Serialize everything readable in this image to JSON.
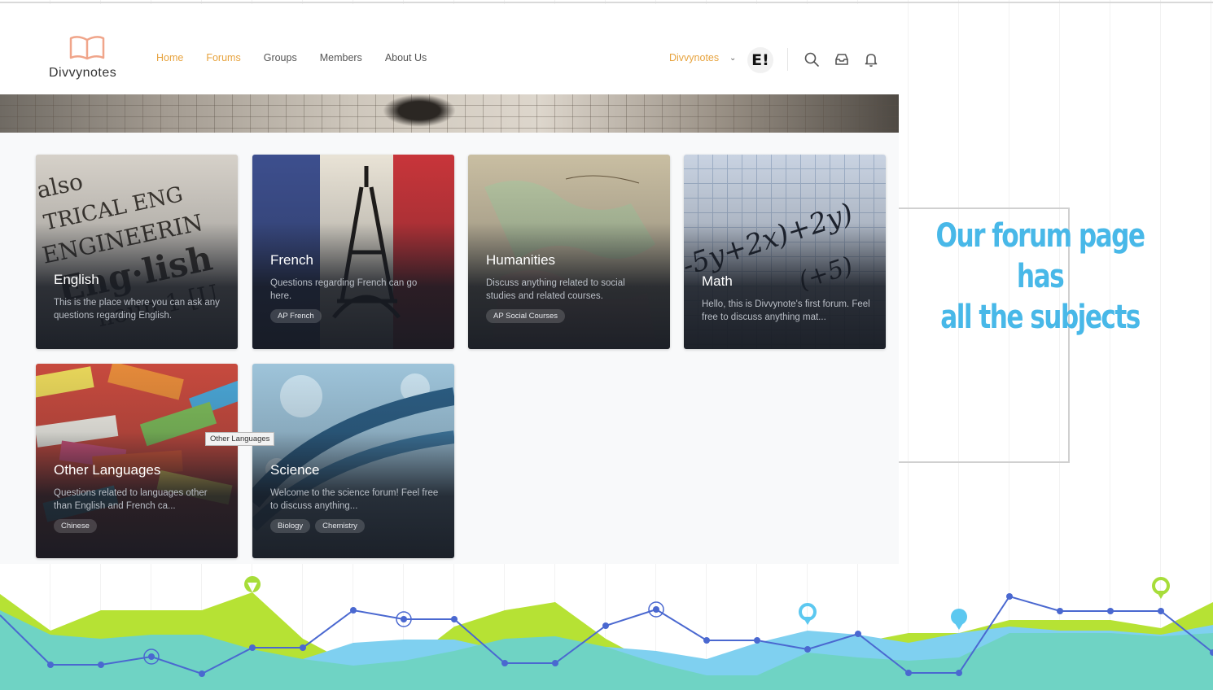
{
  "app": {
    "brand": "Divvynotes",
    "accent_color": "#e7a33e"
  },
  "nav": {
    "links": [
      {
        "label": "Home",
        "active": true
      },
      {
        "label": "Forums",
        "active": true
      },
      {
        "label": "Groups",
        "active": false
      },
      {
        "label": "Members",
        "active": false
      },
      {
        "label": "About Us",
        "active": false
      }
    ],
    "user_name": "Divvynotes",
    "avatar_text": "E!",
    "icons": [
      "search-icon",
      "inbox-icon",
      "bell-icon"
    ]
  },
  "forums": [
    {
      "title": "English",
      "description": "This is the place where you can ask any questions regarding English.",
      "tags": [],
      "image": "english-dictionary"
    },
    {
      "title": "French",
      "description": "Questions regarding French can go here.",
      "tags": [
        "AP French"
      ],
      "image": "eiffel-tower-flag"
    },
    {
      "title": "Humanities",
      "description": "Discuss anything related to social studies and related courses.",
      "tags": [
        "AP Social Courses"
      ],
      "image": "old-map"
    },
    {
      "title": "Math",
      "description": "Hello, this is Divvynote's first forum. Feel free to discuss anything mat...",
      "tags": [],
      "image": "math-graph-paper"
    },
    {
      "title": "Other Languages",
      "description": "Questions related to languages other than English and French ca...",
      "tags": [
        "Chinese"
      ],
      "image": "thank-you-words"
    },
    {
      "title": "Science",
      "description": "Welcome to the science forum! Feel free to discuss anything...",
      "tags": [
        "Biology",
        "Chemistry"
      ],
      "image": "dna-helix"
    }
  ],
  "tooltip": "Other Languages",
  "callout": {
    "line1": "Our forum page has",
    "line2": "all the subjects",
    "color": "#48b8e8"
  },
  "decor_colors": {
    "green": "#b6e234",
    "teal": "#6fd3c4",
    "blue": "#4a68d0",
    "light_blue": "#7fd0f0"
  }
}
